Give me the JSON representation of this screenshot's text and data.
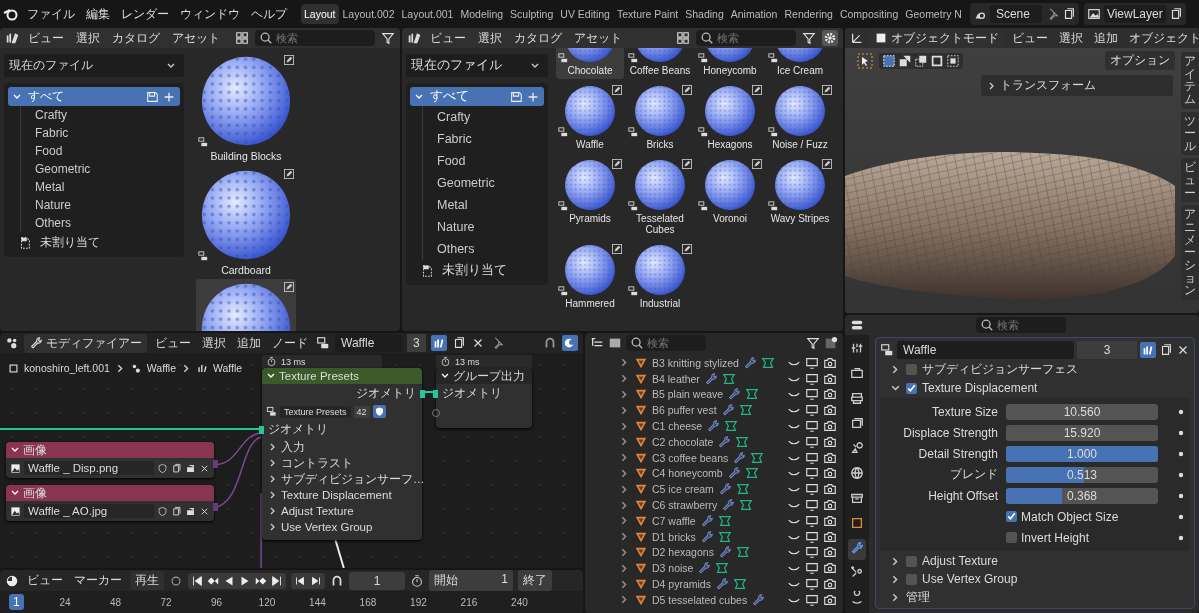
{
  "topbar": {
    "menus": [
      "ファイル",
      "編集",
      "レンダー",
      "ウィンドウ",
      "ヘルプ"
    ],
    "workspaces": [
      {
        "label": "Layout",
        "selected": true
      },
      {
        "label": "Layout.002",
        "selected": false
      },
      {
        "label": "Layout.001",
        "selected": false
      },
      {
        "label": "Modeling",
        "selected": false
      },
      {
        "label": "Sculpting",
        "selected": false
      },
      {
        "label": "UV Editing",
        "selected": false
      },
      {
        "label": "Texture Paint",
        "selected": false
      },
      {
        "label": "Shading",
        "selected": false
      },
      {
        "label": "Animation",
        "selected": false
      },
      {
        "label": "Rendering",
        "selected": false
      },
      {
        "label": "Compositing",
        "selected": false
      },
      {
        "label": "Geometry N",
        "selected": false
      }
    ],
    "scene": "Scene",
    "view_layer": "ViewLayer"
  },
  "asset_browsers": [
    {
      "menus": [
        "ビュー",
        "選択",
        "カタログ",
        "アセット"
      ],
      "search_placeholder": "検索",
      "library": "現在のファイル",
      "catalog_root": {
        "label": "すべて",
        "selected": true
      },
      "catalogs": [
        {
          "label": "Crafty",
          "selected": false
        },
        {
          "label": "Fabric",
          "selected": false
        },
        {
          "label": "Food",
          "selected": false
        },
        {
          "label": "Geometric",
          "selected": false
        },
        {
          "label": "Metal",
          "selected": false
        },
        {
          "label": "Nature",
          "selected": false
        },
        {
          "label": "Others",
          "selected": false
        }
      ],
      "unassigned": "未割り当て",
      "assets": [
        {
          "name": "Building Blocks",
          "selected": false
        },
        {
          "name": "Cardboard",
          "selected": false
        },
        {
          "selected": true
        }
      ]
    },
    {
      "menus": [
        "ビュー",
        "選択",
        "カタログ",
        "アセット"
      ],
      "search_placeholder": "検索",
      "library": "現在のファイル",
      "catalog_root": {
        "label": "すべて",
        "selected": true
      },
      "catalogs": [
        {
          "label": "Crafty",
          "selected": false
        },
        {
          "label": "Fabric",
          "selected": false
        },
        {
          "label": "Food",
          "selected": false
        },
        {
          "label": "Geometric",
          "selected": false
        },
        {
          "label": "Metal",
          "selected": false
        },
        {
          "label": "Nature",
          "selected": false
        },
        {
          "label": "Others",
          "selected": false
        }
      ],
      "unassigned": "未割り当て",
      "assets": [
        {
          "name": "Chocolate",
          "selected": true
        },
        {
          "name": "Coffee Beans",
          "selected": false
        },
        {
          "name": "Honeycomb",
          "selected": false
        },
        {
          "name": "Ice Cream",
          "selected": false
        },
        {
          "name": "Waffle",
          "selected": false
        },
        {
          "name": "Bricks",
          "selected": false
        },
        {
          "name": "Hexagons",
          "selected": false
        },
        {
          "name": "Noise / Fuzz",
          "selected": false
        },
        {
          "name": "Pyramids",
          "selected": false
        },
        {
          "name": "Tesselated Cubes",
          "selected": false
        },
        {
          "name": "Voronoi",
          "selected": false
        },
        {
          "name": "Wavy Stripes",
          "selected": false
        },
        {
          "name": "Hammered",
          "selected": false
        },
        {
          "name": "Industrial",
          "selected": false
        }
      ]
    }
  ],
  "viewport": {
    "mode": "オブジェクトモード",
    "menus": [
      "ビュー",
      "選択",
      "追加",
      "オブジェクト"
    ],
    "options": "オプション",
    "panel": "トランスフォーム",
    "side_tabs": [
      "アイテム",
      "ツール",
      "ビュー",
      "アニメーション"
    ]
  },
  "node_editor": {
    "editor": "モディファイアー",
    "menus": [
      "ビュー",
      "選択",
      "追加",
      "ノード"
    ],
    "group": "Waffle",
    "users": "3",
    "breadcrumbs": [
      "konoshiro_left.001",
      "Waffle",
      "Waffle"
    ],
    "presets_node": {
      "timing": "13 ms",
      "title": "Texture Presets",
      "output": "ジオメトリ",
      "datablock": "Texture Presets",
      "users": "42",
      "input": "ジオメトリ",
      "panels": [
        "入力",
        "コントラスト",
        "サブディビジョンサーフ…",
        "Texture Displacement",
        "Adjust Texture",
        "Use Vertex Group"
      ]
    },
    "output_node": {
      "timing": "13 ms",
      "title": "グループ出力",
      "input": "ジオメトリ"
    },
    "image_nodes": [
      {
        "title": "画像",
        "file": "Waffle _ Disp.png"
      },
      {
        "title": "画像",
        "file": "Waffle _ AO.jpg"
      }
    ]
  },
  "timeline": {
    "menus": [
      "ビュー",
      "マーカー"
    ],
    "playback": "再生",
    "frame": "1",
    "start_label": "開始",
    "start": "1",
    "end_label": "終了",
    "current_frame": "1",
    "ticks": [
      "24",
      "48",
      "72",
      "96",
      "120",
      "144",
      "168",
      "192",
      "216",
      "240"
    ]
  },
  "outliner": {
    "search_placeholder": "検索",
    "rows": [
      {
        "name": "B3 knitting stylized",
        "node_modifier": true
      },
      {
        "name": "B4 leather",
        "node_modifier": true
      },
      {
        "name": "B5 plain weave",
        "node_modifier": true
      },
      {
        "name": "B6 puffer vest",
        "node_modifier": true
      },
      {
        "name": "C1 cheese",
        "node_modifier": true
      },
      {
        "name": "C2 chocolate",
        "node_modifier": true
      },
      {
        "name": "C3 coffee beans",
        "node_modifier": true
      },
      {
        "name": "C4 honeycomb",
        "node_modifier": true
      },
      {
        "name": "C5 ice cream",
        "node_modifier": true
      },
      {
        "name": "C6 strawberry",
        "node_modifier": true
      },
      {
        "name": "C7 waffle",
        "node_modifier": true
      },
      {
        "name": "D1 bricks",
        "node_modifier": true
      },
      {
        "name": "D2 hexagons",
        "node_modifier": true
      },
      {
        "name": "D3 noise",
        "node_modifier": true
      },
      {
        "name": "D4 pyramids",
        "node_modifier": true
      },
      {
        "name": "D5 tesselated cubes",
        "node_modifier": false
      }
    ]
  },
  "properties": {
    "search_placeholder": "検索",
    "tabs": [
      {
        "kind": "tool",
        "selected": false
      },
      {
        "kind": "render",
        "selected": false
      },
      {
        "kind": "output",
        "selected": false
      },
      {
        "kind": "view_layer",
        "selected": false
      },
      {
        "kind": "scene",
        "selected": false
      },
      {
        "kind": "world",
        "selected": false
      },
      {
        "kind": "collection",
        "selected": false
      },
      {
        "kind": "object",
        "selected": false
      },
      {
        "kind": "modifier",
        "selected": true
      },
      {
        "kind": "particles",
        "selected": false
      },
      {
        "kind": "physics",
        "selected": false
      }
    ],
    "modifier": {
      "name": "Waffle",
      "users": "3",
      "panels": [
        {
          "kind": "toggle",
          "label": "サブディビジョンサーフェス",
          "expanded": false,
          "enabled": false
        },
        {
          "kind": "toggle",
          "label": "Texture Displacement",
          "expanded": true,
          "enabled": true,
          "fields": [
            {
              "kind": "number",
              "label": "Texture Size",
              "value": "10.560"
            },
            {
              "kind": "number",
              "label": "Displace Strength",
              "value": "15.920"
            },
            {
              "kind": "slider",
              "label": "Detail Strength",
              "value": "1.000",
              "level": 1
            },
            {
              "kind": "slider",
              "label": "ブレンド",
              "value": "0.513",
              "level": 0.513
            },
            {
              "kind": "slider",
              "label": "Height Offset",
              "value": "0.368",
              "level": 0.368
            },
            {
              "kind": "checkbox",
              "label": "Match Object Size",
              "checked": true
            },
            {
              "kind": "checkbox",
              "label": "Invert Height",
              "checked": false
            }
          ]
        },
        {
          "kind": "toggle",
          "label": "Adjust Texture",
          "expanded": false,
          "enabled": false
        },
        {
          "kind": "toggle",
          "label": "Use Vertex Group",
          "expanded": false,
          "enabled": false
        },
        {
          "kind": "plain",
          "label": "管理",
          "expanded": false
        }
      ]
    }
  }
}
